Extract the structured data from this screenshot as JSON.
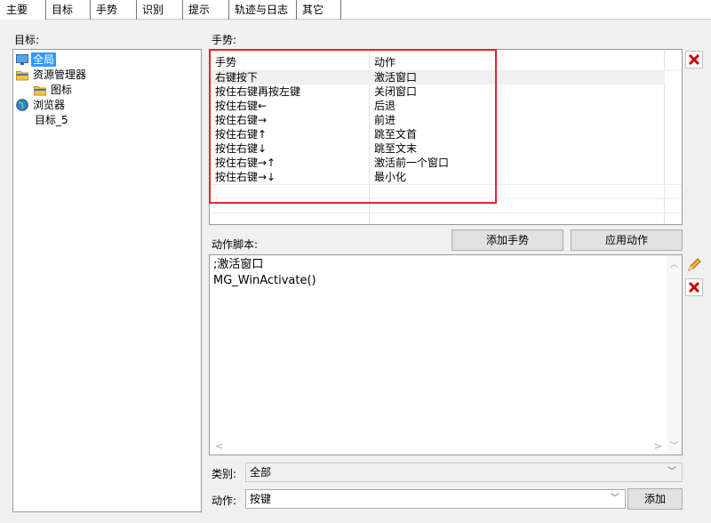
{
  "tabs": [
    "主要",
    "目标",
    "手势",
    "识别",
    "提示",
    "轨迹与日志",
    "其它"
  ],
  "targets_label": "目标:",
  "gestures_label": "手势:",
  "tree": [
    {
      "label": "全局",
      "icon": "monitor-icon",
      "selected": true
    },
    {
      "label": "资源管理器",
      "icon": "folder-icon",
      "selected": false
    },
    {
      "label": "图标",
      "icon": "folder-icon",
      "selected": false
    },
    {
      "label": "浏览器",
      "icon": "globe-icon",
      "selected": false
    },
    {
      "label": "目标_5",
      "icon": "",
      "selected": false
    }
  ],
  "table": {
    "headers": [
      "手势",
      "动作"
    ],
    "rows": [
      [
        "右键按下",
        "激活窗口"
      ],
      [
        "按住右键再按左键",
        "关闭窗口"
      ],
      [
        "按住右键←",
        "后退"
      ],
      [
        "按住右键→",
        "前进"
      ],
      [
        "按住右键↑",
        "跳至文首"
      ],
      [
        "按住右键↓",
        "跳至文末"
      ],
      [
        "按住右键→↑",
        "激活前一个窗口"
      ],
      [
        "按住右键→↓",
        "最小化"
      ]
    ]
  },
  "buttons": {
    "add_gesture": "添加手势",
    "apply_action": "应用动作",
    "add": "添加"
  },
  "script_label": "动作脚本:",
  "script_lines": [
    ";激活窗口",
    "MG_WinActivate()"
  ],
  "category_label": "类别:",
  "category_value": "全部",
  "action_label": "动作:",
  "action_value": "按键",
  "colors": {
    "highlight": "#3399ff",
    "red_box": "#e0262e",
    "delete_red": "#cc0000"
  }
}
